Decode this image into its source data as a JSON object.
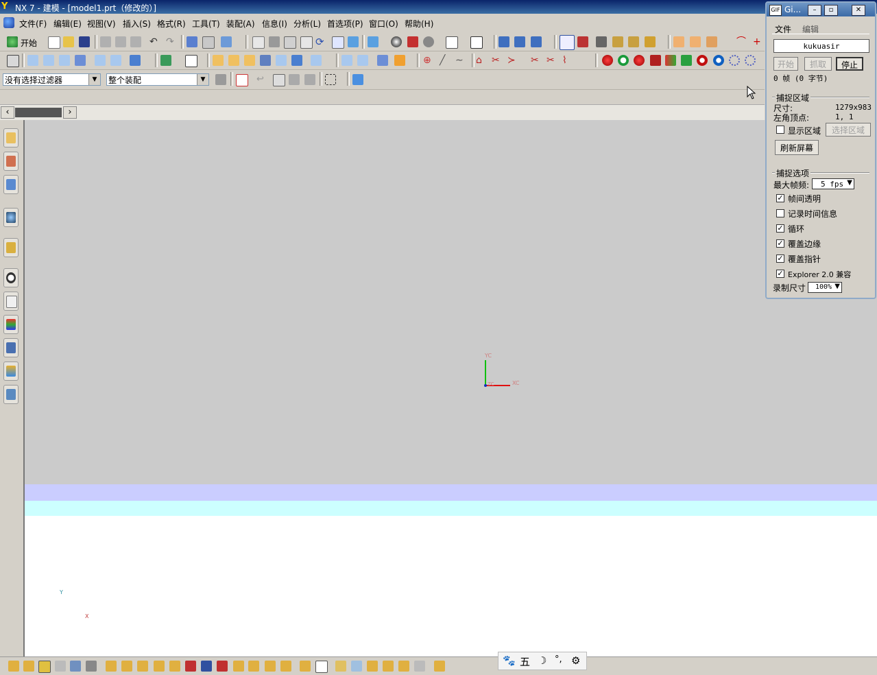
{
  "window": {
    "title": "NX 7 - 建模 - [model1.prt（修改的）]"
  },
  "menu": {
    "items": [
      {
        "label": "文件(F)"
      },
      {
        "label": "编辑(E)"
      },
      {
        "label": "视图(V)"
      },
      {
        "label": "插入(S)"
      },
      {
        "label": "格式(R)"
      },
      {
        "label": "工具(T)"
      },
      {
        "label": "装配(A)"
      },
      {
        "label": "信息(I)"
      },
      {
        "label": "分析(L)"
      },
      {
        "label": "首选项(P)"
      },
      {
        "label": "窗口(O)"
      },
      {
        "label": "帮助(H)"
      }
    ]
  },
  "toolbar": {
    "start_label": "开始"
  },
  "filters": {
    "selection_filter": "没有选择过滤器",
    "assembly_scope": "整个装配"
  },
  "viewport": {
    "wcs": {
      "x": "XC",
      "y": "YC",
      "z": "ZC"
    },
    "abs": {
      "x": "X",
      "y": "Y"
    }
  },
  "ime": {
    "mode_char": "五"
  },
  "gif": {
    "title": "Gi...",
    "menu": {
      "file": "文件",
      "edit": "编辑"
    },
    "author": "kukuasir",
    "buttons": {
      "start": "开始",
      "capture": "抓取",
      "stop": "停止"
    },
    "frames_info": "0 帧 (0 字节)",
    "region": {
      "heading": "捕捉区域",
      "size_label": "尺寸:",
      "size_value": "1279x983",
      "corner_label": "左角顶点:",
      "corner_value": "1, 1",
      "show_region": "显示区域",
      "select_region": "选择区域",
      "refresh": "刷新屏幕"
    },
    "options": {
      "heading": "捕捉选项",
      "max_fps_label": "最大帧频:",
      "max_fps_value": "5 fps",
      "frame_transparency": "帧间透明",
      "record_time": "记录时间信息",
      "loop": "循环",
      "cover_edges": "覆盖边缘",
      "cover_pointer": "覆盖指针",
      "explorer_compat": "Explorer 2.0 兼容",
      "record_size_label": "录制尺寸",
      "record_size_value": "100%"
    }
  }
}
